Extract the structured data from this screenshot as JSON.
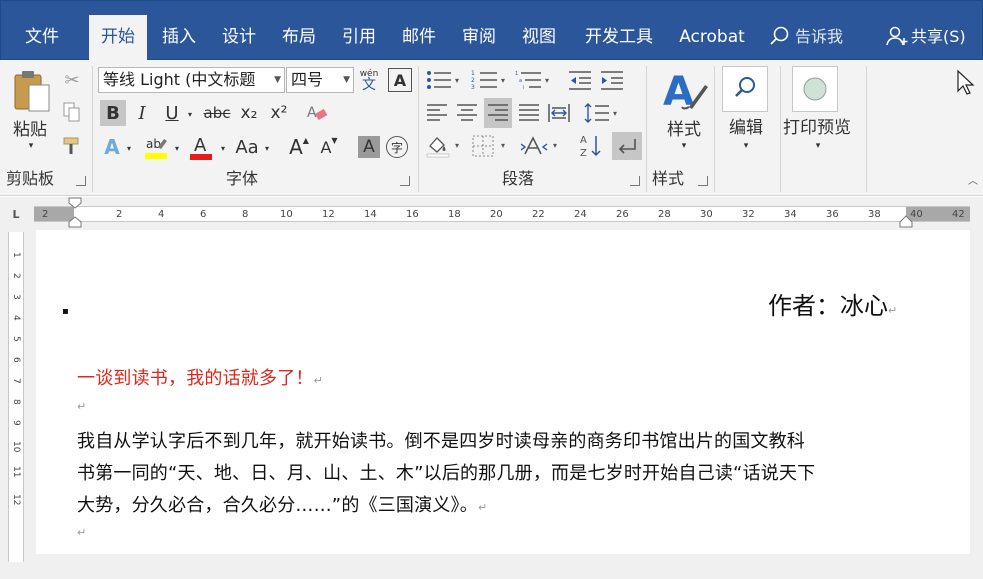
{
  "tabs": [
    {
      "label": "文件"
    },
    {
      "label": "开始"
    },
    {
      "label": "插入"
    },
    {
      "label": "设计"
    },
    {
      "label": "布局"
    },
    {
      "label": "引用"
    },
    {
      "label": "邮件"
    },
    {
      "label": "审阅"
    },
    {
      "label": "视图"
    },
    {
      "label": "开发工具"
    },
    {
      "label": "Acrobat"
    }
  ],
  "tellme": {
    "label": "告诉我"
  },
  "share": {
    "label": "共享(S)"
  },
  "ribbon": {
    "clipboard": {
      "paste_label": "粘贴",
      "group_label": "剪贴板"
    },
    "font": {
      "font_name": "等线 Light (中文标题",
      "font_size": "四号",
      "phonetic_top": "wén",
      "phonetic_bottom": "文",
      "charborder": "A",
      "bold": "B",
      "italic": "I",
      "underline": "U",
      "strike": "abc",
      "subscript": "x₂",
      "superscript": "x²",
      "change_case": "Aa",
      "grow": "A",
      "shrink": "A",
      "shade": "A",
      "enclose": "字",
      "group_label": "字体"
    },
    "paragraph": {
      "group_label": "段落"
    },
    "styles": {
      "label": "样式",
      "group_label": "样式"
    },
    "editing": {
      "label": "编辑"
    },
    "print_preview": {
      "label": "打印预览"
    }
  },
  "ruler": {
    "numbers": [
      "2",
      "2",
      "4",
      "6",
      "8",
      "10",
      "12",
      "14",
      "16",
      "18",
      "20",
      "22",
      "24",
      "26",
      "28",
      "30",
      "32",
      "34",
      "36",
      "38",
      "40",
      "42"
    ],
    "vertical_numbers": [
      "1",
      "2",
      "3",
      "4",
      "5",
      "6",
      "7",
      "8",
      "9",
      "10",
      "11",
      "12"
    ]
  },
  "document": {
    "author": "作者：冰心",
    "heading": "一谈到读书，我的话就多了！",
    "para1_line1": "我自从学认字后不到几年，就开始读书。倒不是四岁时读母亲的商务印书馆出片的国文教科",
    "para1_line2": "书第一同的“天、地、日、月、山、土、木”以后的那几册，而是七岁时开始自己读“话说天下",
    "para1_line3": "大势，分久必合，合久必分……”的《三国演义》。",
    "para_mark": "↵",
    "bullet": "▪"
  },
  "colors": {
    "tab_bar": "#2b579a",
    "ribbon": "#f3f3f3",
    "heading_red": "#e0261a"
  }
}
